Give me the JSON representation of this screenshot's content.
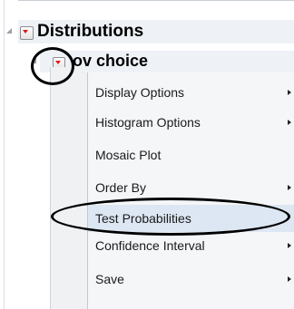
{
  "report": {
    "title": "Distributions",
    "sub_title": "Fav choice",
    "sub_title_visible": "ov choice"
  },
  "menu": {
    "items": [
      {
        "label": "Display Options",
        "has_submenu": true
      },
      {
        "label": "Histogram Options",
        "has_submenu": true
      },
      {
        "label": "Mosaic Plot",
        "has_submenu": false
      },
      {
        "label": "Order By",
        "has_submenu": true
      },
      {
        "label": "Test Probabilities",
        "has_submenu": false,
        "highlighted": true
      },
      {
        "label": "Confidence Interval",
        "has_submenu": true
      },
      {
        "label": "Save",
        "has_submenu": true
      }
    ]
  },
  "annotations": {
    "circled_items": [
      "red-triangle-button",
      "Test Probabilities"
    ],
    "circle_color": "#000000"
  },
  "colors": {
    "red_triangle": "#e01818",
    "menu_background": "#f5f6f8",
    "highlight": "#dde7f3"
  }
}
